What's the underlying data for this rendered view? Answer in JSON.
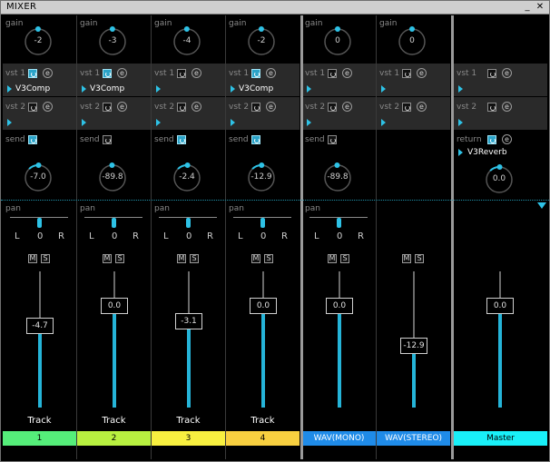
{
  "window": {
    "title": "MIXER",
    "minimize_glyph": "_",
    "close_glyph": "✕"
  },
  "labels": {
    "gain": "gain",
    "vst1": "vst 1",
    "vst2": "vst 2",
    "send": "send",
    "return": "return",
    "pan": "pan",
    "pan_left": "L",
    "pan_center": "0",
    "pan_right": "R",
    "mute": "M",
    "solo": "S",
    "edit": "e"
  },
  "colors": {
    "accent": "#2ec2e6",
    "chan1": "#55ee7a",
    "chan2": "#b8f040",
    "chan3": "#f8f040",
    "chan4": "#f8d040",
    "wav": "#1f8be8",
    "master": "#19f0f8"
  },
  "channels": [
    {
      "id": "c1",
      "gain": "-2",
      "vst1_on": true,
      "vst1_plugin": "V3Comp",
      "vst2_plugin": "",
      "send_on": true,
      "send_value": "-7.0",
      "pan": "0",
      "fader": "-4.7",
      "name": "Track",
      "number": "1",
      "color_key": "chan1"
    },
    {
      "id": "c2",
      "gain": "-3",
      "vst1_on": true,
      "vst1_plugin": "V3Comp",
      "vst2_plugin": "",
      "send_on": false,
      "send_value": "-89.8",
      "pan": "0",
      "fader": "0.0",
      "name": "Track",
      "number": "2",
      "color_key": "chan2"
    },
    {
      "id": "c3",
      "gain": "-4",
      "vst1_on": false,
      "vst1_plugin": "",
      "vst2_plugin": "",
      "send_on": true,
      "send_value": "-2.4",
      "pan": "0",
      "fader": "-3.1",
      "name": "Track",
      "number": "3",
      "color_key": "chan3"
    },
    {
      "id": "c4",
      "gain": "-2",
      "vst1_on": true,
      "vst1_plugin": "V3Comp",
      "vst2_plugin": "",
      "send_on": true,
      "send_value": "-12.9",
      "pan": "0",
      "fader": "0.0",
      "name": "Track",
      "number": "4",
      "color_key": "chan4"
    },
    {
      "id": "c5",
      "gain": "0",
      "vst1_on": false,
      "vst1_plugin": "",
      "vst2_plugin": "",
      "send_on": false,
      "send_value": "-89.8",
      "pan": "0",
      "fader": "0.0",
      "name": "",
      "number": "WAV(MONO)",
      "color_key": "wav"
    },
    {
      "id": "c6",
      "gain": "0",
      "vst1_on": false,
      "vst1_plugin": "",
      "vst2_plugin": "",
      "send_on": null,
      "send_value": "",
      "pan": "",
      "fader": "-12.9",
      "name": "",
      "number": "WAV(STEREO)",
      "color_key": "wav"
    }
  ],
  "master": {
    "vst1_on": false,
    "vst2_on": false,
    "return_on": true,
    "return_plugin": "V3Reverb",
    "return_value": "0.0",
    "fader": "0.0",
    "number": "Master"
  }
}
